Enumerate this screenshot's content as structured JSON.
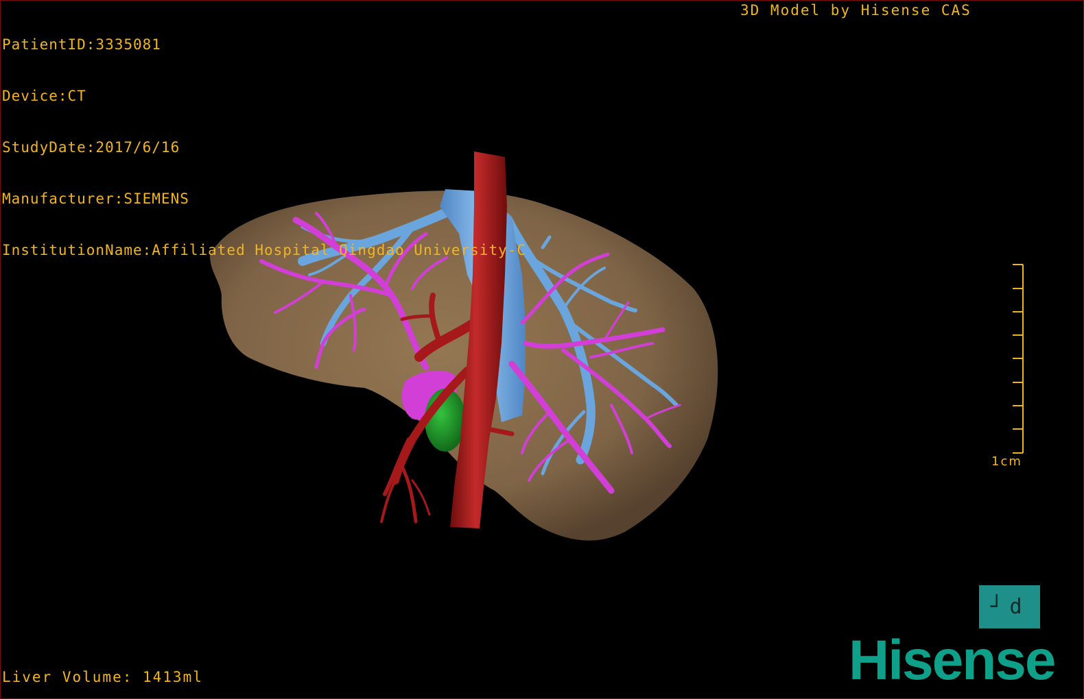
{
  "patient_info": {
    "patient_id": "PatientID:3335081",
    "device": "Device:CT",
    "study_date": "StudyDate:2017/6/16",
    "manufacturer": "Manufacturer:SIEMENS",
    "institution": "InstitutionName:Affiliated Hospital Qingdao University-C"
  },
  "credit": "3D Model by Hisense CAS",
  "liver_volume": "Liver Volume: 1413ml",
  "scale_bar": {
    "label": "1cm"
  },
  "orientation_cube": {
    "face_label": "┘d"
  },
  "brand_logo": "Hisense",
  "colors": {
    "overlay_text": "#f2b51f",
    "liver": "#8a6e4b",
    "portal_vein": "#d23fd6",
    "hepatic_vein": "#6aa6dd",
    "artery": "#a5191b",
    "gallbladder": "#1f9a2c",
    "brand": "#0fa08a",
    "cube": "#1f8f89"
  }
}
